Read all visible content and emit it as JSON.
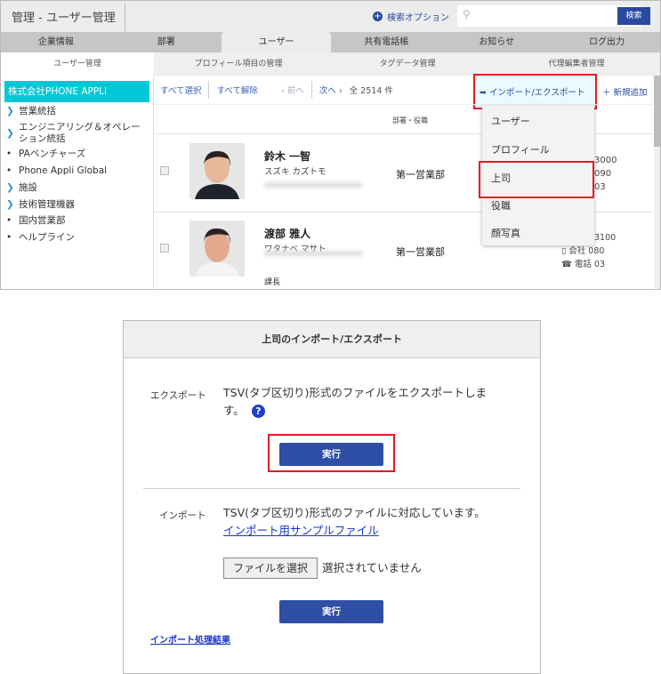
{
  "header": {
    "breadcrumb": "管理 - ユーザー管理",
    "search_option": "検索オプション",
    "search_placeholder": "",
    "search_button": "検索"
  },
  "tabs": [
    "企業情報",
    "部署",
    "ユーザー",
    "共有電話帳",
    "お知らせ",
    "ログ出力"
  ],
  "subtabs": [
    "ユーザー管理",
    "プロフィール項目の管理",
    "タグデータ管理",
    "代理編集者管理"
  ],
  "sidebar": {
    "selected": "株式会社PHONE APPLI",
    "items": [
      {
        "label": "営業統括",
        "marker": "chevron"
      },
      {
        "label": "エンジニアリング＆オペレーション統括",
        "marker": "chevron"
      },
      {
        "label": "PAベンチャーズ",
        "marker": "bullet"
      },
      {
        "label": "Phone Appli Global",
        "marker": "bullet"
      },
      {
        "label": "施設",
        "marker": "chevron"
      },
      {
        "label": "技術管理機器",
        "marker": "chevron"
      },
      {
        "label": "国内営業部",
        "marker": "bullet"
      },
      {
        "label": "ヘルプライン",
        "marker": "bullet"
      }
    ]
  },
  "toolbar": {
    "select_all": "すべて選択",
    "deselect_all": "すべて解除",
    "prev": "前へ",
    "next": "次へ",
    "total": "全 2514 件",
    "import_export": "インポート/エクスポート",
    "add_new": "新規追加"
  },
  "columns": {
    "dept_title": "部署・役職"
  },
  "users": [
    {
      "name": "鈴木 一智",
      "kana": "スズキ カズトモ",
      "dept": "第一営業部",
      "title": "",
      "phones": [
        "3000",
        "090",
        "03"
      ]
    },
    {
      "name": "渡部 雅人",
      "kana": "ワタナベ マサト",
      "dept": "第一営業部",
      "title": "課長",
      "phones": [
        "3100",
        "080",
        "03"
      ],
      "phone_labels": [
        "会社",
        "電話"
      ]
    }
  ],
  "dropdown": [
    "ユーザー",
    "プロフィール",
    "上司",
    "役職",
    "顔写真"
  ],
  "dialog": {
    "title": "上司のインポート/エクスポート",
    "export_label": "エクスポート",
    "export_text": "TSV(タブ区切り)形式のファイルをエクスポートします。",
    "help": "?",
    "run": "実行",
    "import_label": "インポート",
    "import_text": "TSV(タブ区切り)形式のファイルに対応しています。",
    "sample_link": "インポート用サンプルファイル",
    "file_button": "ファイルを選択",
    "file_status": "選択されていません",
    "result_link": "インポート処理結果"
  },
  "colors": {
    "accent": "#2e4fa5",
    "selected": "#00c8d7",
    "highlight": "#e21b23"
  }
}
